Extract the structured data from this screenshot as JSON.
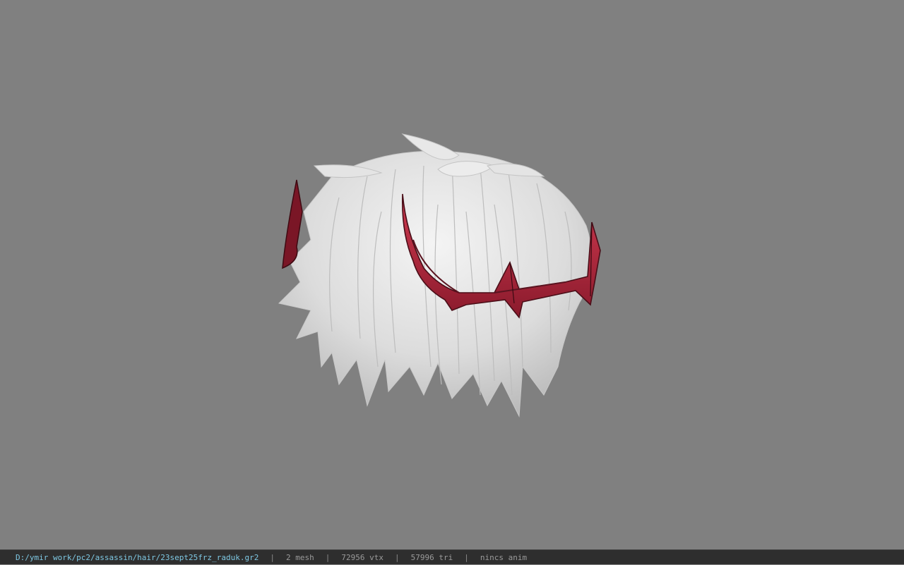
{
  "viewport": {
    "background_color": "#808080",
    "model": {
      "hair_color": "#e6e6e6",
      "crown_color": "#c0283f",
      "crown_dark_color": "#5a1420"
    }
  },
  "status_bar": {
    "file_path": "D:/ymir work/pc2/assassin/hair/23sept25frz_raduk.gr2",
    "separator": "|",
    "mesh_count": "2 mesh",
    "vertex_count": "72956 vtx",
    "triangle_count": "57996 tri",
    "anim_info": "nincs anim",
    "path_color": "#7ec8e3"
  }
}
